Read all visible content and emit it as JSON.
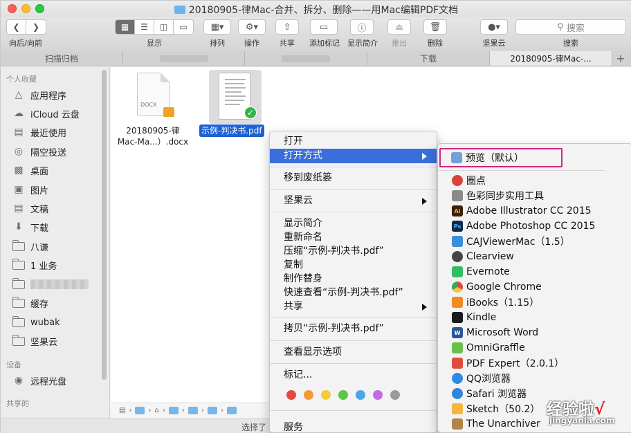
{
  "window": {
    "title": "20180905-律Mac-合并、拆分、删除——用Mac编辑PDF文档"
  },
  "toolbar": {
    "nav_label": "向后/向前",
    "view_label": "显示",
    "sort_label": "排列",
    "action_label": "操作",
    "share_label": "共享",
    "tags_label": "添加标记",
    "info_label": "显示简介",
    "eject_label": "推出",
    "delete_label": "删除",
    "jianguo_label": "坚果云",
    "search_label": "搜索",
    "search_placeholder": "搜索"
  },
  "tabs": [
    {
      "label": "扫描归档"
    },
    {
      "label": ""
    },
    {
      "label": ""
    },
    {
      "label": "下载"
    },
    {
      "label": "20180905-律Mac-..."
    }
  ],
  "sidebar": {
    "favorites_header": "个人收藏",
    "items": [
      {
        "label": "应用程序",
        "icon": "applications-icon"
      },
      {
        "label": "iCloud 云盘",
        "icon": "icloud-icon"
      },
      {
        "label": "最近使用",
        "icon": "recents-icon"
      },
      {
        "label": "隔空投送",
        "icon": "airdrop-icon"
      },
      {
        "label": "桌面",
        "icon": "desktop-icon"
      },
      {
        "label": "图片",
        "icon": "pictures-icon"
      },
      {
        "label": "文稿",
        "icon": "documents-icon"
      },
      {
        "label": "下载",
        "icon": "downloads-icon"
      },
      {
        "label": "八谦",
        "icon": "folder-icon"
      },
      {
        "label": "1 业务",
        "icon": "folder-icon"
      },
      {
        "label": "",
        "icon": "folder-icon"
      },
      {
        "label": "缓存",
        "icon": "folder-icon"
      },
      {
        "label": "wubak",
        "icon": "folder-icon"
      },
      {
        "label": "坚果云",
        "icon": "folder-icon"
      }
    ],
    "devices_header": "设备",
    "devices": [
      {
        "label": "远程光盘",
        "icon": "remote-disc-icon"
      }
    ],
    "shared_header": "共享的"
  },
  "files": [
    {
      "name_line1": "20180905-律",
      "name_line2": "Mac-Ma...）.docx",
      "badge": "DOCX"
    },
    {
      "name": "示例-判决书.pdf"
    }
  ],
  "status": {
    "text": "选择了"
  },
  "context_menu": {
    "items": [
      {
        "label": "打开"
      },
      {
        "label": "打开方式"
      },
      {
        "label": "移到废纸篓"
      },
      {
        "label": "坚果云"
      },
      {
        "label": "显示简介"
      },
      {
        "label": "重新命名"
      },
      {
        "label": "压缩“示例-判决书.pdf”"
      },
      {
        "label": "复制"
      },
      {
        "label": "制作替身"
      },
      {
        "label": "快速查看“示例-判决书.pdf”"
      },
      {
        "label": "共享"
      },
      {
        "label": "拷贝“示例-判决书.pdf”"
      },
      {
        "label": "查看显示选项"
      },
      {
        "label": "标记..."
      },
      {
        "label": "服务"
      }
    ],
    "tag_colors": [
      "#e24b3f",
      "#f39a37",
      "#f2cd3a",
      "#5cc54a",
      "#4aa7e6",
      "#c26be0",
      "#9a9a9a"
    ]
  },
  "open_with": {
    "default": {
      "label": "预览（默认）"
    },
    "apps": [
      {
        "label": "圈点",
        "color": "#d9413c"
      },
      {
        "label": "色彩同步实用工具",
        "color": "#8a8a8a"
      },
      {
        "label": "Adobe Illustrator CC 2015",
        "color": "#3a1f0a"
      },
      {
        "label": "Adobe Photoshop CC 2015",
        "color": "#0b2a4d"
      },
      {
        "label": "CAJViewerMac（1.5）",
        "color": "#3a8fd8"
      },
      {
        "label": "Clearview",
        "color": "#444444"
      },
      {
        "label": "Evernote",
        "color": "#2dbe60"
      },
      {
        "label": "Google Chrome",
        "color": "#e0493a"
      },
      {
        "label": "iBooks（1.15）",
        "color": "#f08a24"
      },
      {
        "label": "Kindle",
        "color": "#1a1a1a"
      },
      {
        "label": "Microsoft Word",
        "color": "#2b5797"
      },
      {
        "label": "OmniGraffle",
        "color": "#6abf4b"
      },
      {
        "label": "PDF Expert（2.0.1）",
        "color": "#e14a3c"
      },
      {
        "label": "QQ浏览器",
        "color": "#2f8ae3"
      },
      {
        "label": "Safari 浏览器",
        "color": "#2f86d8"
      },
      {
        "label": "Sketch（50.2）",
        "color": "#f5b63a"
      },
      {
        "label": "The Unarchiver",
        "color": "#b2844c"
      }
    ]
  },
  "watermark": {
    "text": "经验啦",
    "tick": "√",
    "url": "jingyanla.com"
  }
}
